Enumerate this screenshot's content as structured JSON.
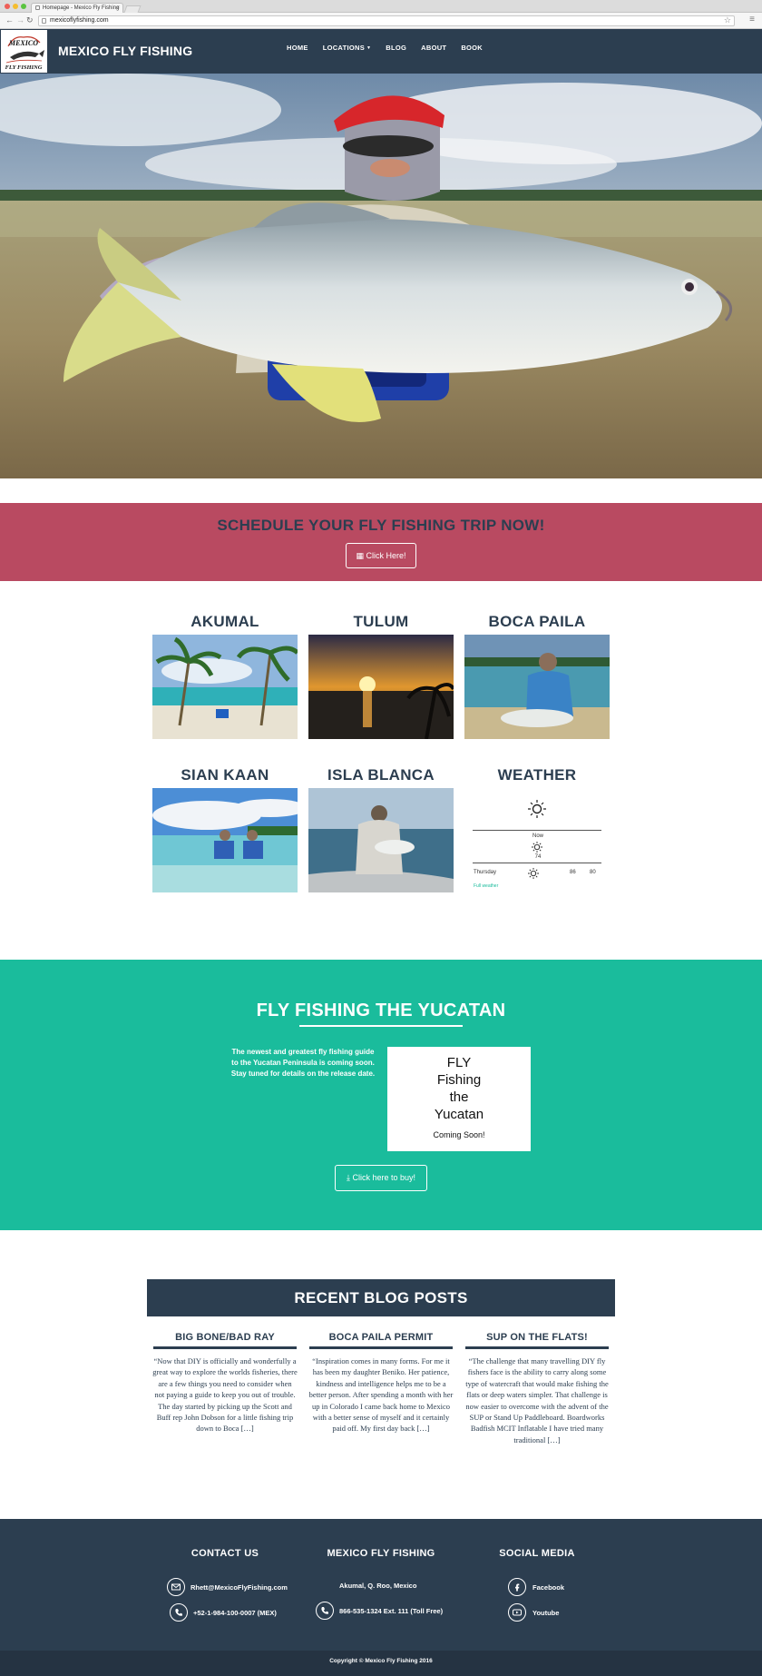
{
  "browser": {
    "tab_title": "Homepage - Mexico Fly Fishing",
    "url": "mexicoflyfishing.com"
  },
  "header": {
    "logo_text_top": "MEXICO",
    "logo_text_bottom": "FLY FISHING",
    "site_title": "MEXICO FLY FISHING",
    "nav": {
      "home": "HOME",
      "locations": "LOCATIONS",
      "blog": "BLOG",
      "about": "ABOUT",
      "book": "BOOK"
    }
  },
  "schedule": {
    "heading": "SCHEDULE YOUR FLY FISHING TRIP NOW!",
    "button": "Click Here!"
  },
  "locations": {
    "akumal": "AKUMAL",
    "tulum": "TULUM",
    "boca_paila": "BOCA PAILA",
    "sian_kaan": "SIAN KAAN",
    "isla_blanca": "ISLA BLANCA",
    "weather": "WEATHER"
  },
  "weather": {
    "now_label": "Now",
    "now_temp": "74",
    "day": "Thursday",
    "high": "86",
    "low": "80",
    "link": "Full weather"
  },
  "yucatan": {
    "heading": "FLY FISHING THE YUCATAN",
    "blurb": "The newest and greatest fly fishing guide to the Yucatan Peninsula is coming soon. Stay tuned for details on the release date.",
    "book_line1": "FLY",
    "book_line2": "Fishing",
    "book_line3": "the",
    "book_line4": "Yucatan",
    "book_sub": "Coming Soon!",
    "button": "Click here to buy!"
  },
  "blog": {
    "heading": "RECENT BLOG POSTS",
    "posts": [
      {
        "title": "BIG BONE/BAD RAY",
        "excerpt": "“Now that DIY is officially and wonderfully a great way to explore the worlds fisheries, there are a few things you need to consider when not paying a guide to keep you out of trouble. The day started by picking up the Scott and Buff rep John Dobson for a little fishing trip down to Boca […]"
      },
      {
        "title": "BOCA PAILA PERMIT",
        "excerpt": "“Inspiration comes in many forms. For me it has been my daughter Beniko. Her patience, kindness and intelligence helps me to be a better person. After spending a month with her up in Colorado I came back home to Mexico with a better sense of myself and it certainly paid off.  My first day back […]"
      },
      {
        "title": "SUP ON THE FLATS!",
        "excerpt": "“The challenge that many travelling DIY fly fishers face is the ability to carry along some type of watercraft that would make fishing the flats or deep waters simpler. That challenge is now easier to overcome with the advent of the SUP or Stand Up Paddleboard. Boardworks Badfish MCIT Inflatable I have tried many traditional […]"
      }
    ]
  },
  "footer": {
    "contact_heading": "CONTACT US",
    "email": "Rhett@MexicoFlyFishing.com",
    "phone_mex": "+52-1-984-100-0007 (MEX)",
    "brand_heading": "MEXICO FLY FISHING",
    "address": "Akumal, Q. Roo, Mexico",
    "phone_toll_free": "866-535-1324  Ext. 111 (Toll Free)",
    "social_heading": "SOCIAL MEDIA",
    "facebook": "Facebook",
    "youtube": "Youtube",
    "copyright": "Copyright © Mexico Fly Fishing 2016"
  },
  "colors": {
    "navy": "#2c3e50",
    "rose": "#b94a61",
    "teal": "#1abc9c"
  }
}
